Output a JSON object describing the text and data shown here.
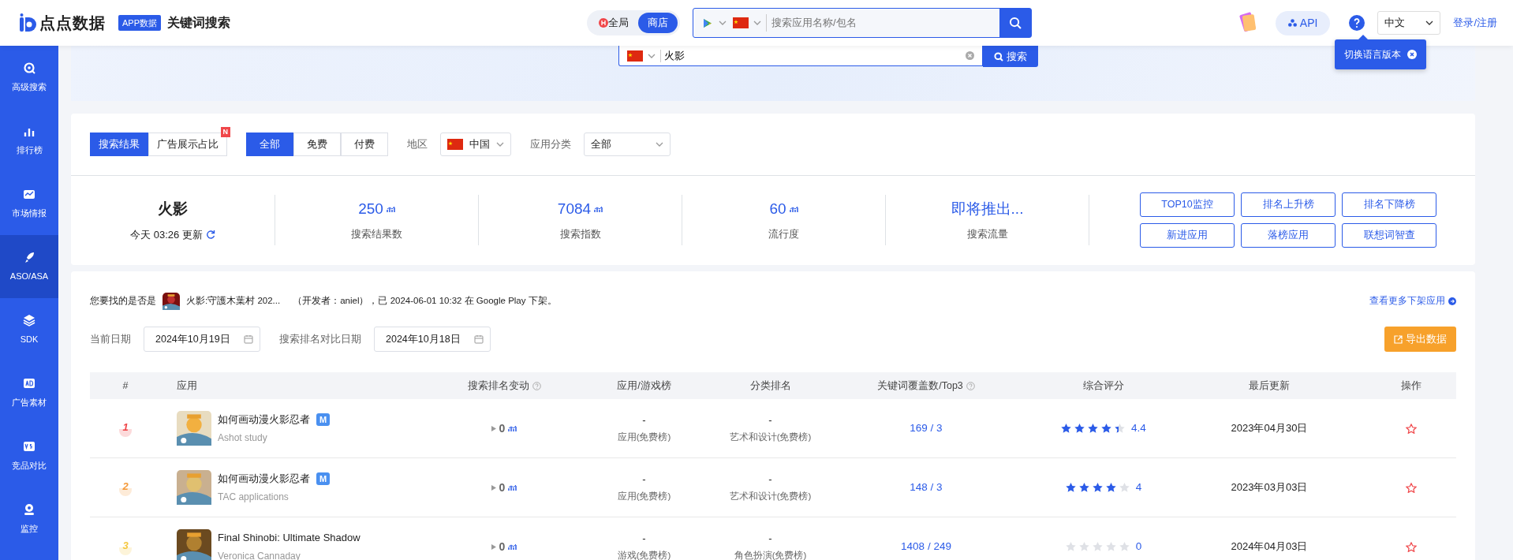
{
  "header": {
    "logo": "点点数据",
    "badge": "APP数据",
    "title": "关键词搜索",
    "scope_toggle": [
      {
        "label": "全局",
        "selected": false
      },
      {
        "label": "商店",
        "selected": true
      }
    ],
    "search": {
      "placeholder": "搜索应用名称/包名"
    },
    "api": "API",
    "language": "中文",
    "login": "登录/注册"
  },
  "tooltip": {
    "text": "切换语言版本"
  },
  "sidebar": {
    "items": [
      {
        "label": "高级搜索",
        "selected": false
      },
      {
        "label": "排行榜",
        "selected": false
      },
      {
        "label": "市场情报",
        "selected": false
      },
      {
        "label": "ASO/ASA",
        "selected": true
      },
      {
        "label": "SDK",
        "selected": false
      },
      {
        "label": "广告素材",
        "selected": false
      },
      {
        "label": "竞品对比",
        "selected": false
      },
      {
        "label": "监控",
        "selected": false
      }
    ]
  },
  "keyword_search": {
    "value": "火影",
    "button": "搜索"
  },
  "filters": {
    "result_tabs": [
      {
        "label": "搜索结果",
        "selected": true
      },
      {
        "label": "广告展示占比",
        "selected": false,
        "badge": "N"
      }
    ],
    "price_tabs": [
      {
        "label": "全部",
        "selected": true
      },
      {
        "label": "免费",
        "selected": false
      },
      {
        "label": "付费",
        "selected": false
      }
    ],
    "region": {
      "label": "地区",
      "value": "中国"
    },
    "category": {
      "label": "应用分类",
      "value": "全部"
    }
  },
  "summary": {
    "keyword": "火影",
    "updated": "今天 03:26 更新",
    "stats": [
      {
        "value": "250",
        "label": "搜索结果数",
        "chart_link": true
      },
      {
        "value": "7084",
        "label": "搜索指数",
        "chart_link": true
      },
      {
        "value": "60",
        "label": "流行度",
        "chart_link": true
      },
      {
        "value": "即将推出...",
        "label": "搜索流量",
        "chart_link": false
      }
    ],
    "actions": [
      "TOP10监控",
      "排名上升榜",
      "排名下降榜",
      "新进应用",
      "落榜应用",
      "联想词智查"
    ]
  },
  "notice": {
    "prefix": "您要找的是否是",
    "app_name": "火影:守護木葉村 202...",
    "details": "（开发者：aniel），已 2024-06-01 10:32 在 Google Play 下架。",
    "more_link": "查看更多下架应用"
  },
  "dates": {
    "current_label": "当前日期",
    "current": "2024年10月19日",
    "compare_label": "搜索排名对比日期",
    "compare": "2024年10月18日",
    "export": "导出数据"
  },
  "table": {
    "columns": [
      {
        "label": "#",
        "help": false
      },
      {
        "label": "应用",
        "help": false
      },
      {
        "label": "搜索排名变动",
        "help": true
      },
      {
        "label": "应用/游戏榜",
        "help": false
      },
      {
        "label": "分类排名",
        "help": false
      },
      {
        "label": "关键词覆盖数/Top3",
        "help": true
      },
      {
        "label": "综合评分",
        "help": false
      },
      {
        "label": "最后更新",
        "help": false
      },
      {
        "label": "操作",
        "help": false
      }
    ],
    "rows": [
      {
        "rank": "1",
        "color": "#f0474a",
        "app": "如何画动漫火影忍者",
        "badge": "M",
        "developer": "Ashot study",
        "rank_change": "0",
        "list_rank": "-",
        "list_name": "应用(免费榜)",
        "category_rank": "-",
        "category_name": "艺术和设计(免费榜)",
        "keywords": "169 / 3",
        "stars": 4.4,
        "rating": "4.4",
        "updated": "2023年04月30日"
      },
      {
        "rank": "2",
        "color": "#f59a3b",
        "app": "如何画动漫火影忍者",
        "badge": "M",
        "developer": "TAC applications",
        "rank_change": "0",
        "list_rank": "-",
        "list_name": "应用(免费榜)",
        "category_rank": "-",
        "category_name": "艺术和设计(免费榜)",
        "keywords": "148 / 3",
        "stars": 4,
        "rating": "4",
        "updated": "2023年03月03日"
      },
      {
        "rank": "3",
        "color": "#f5c842",
        "app": "Final Shinobi: Ultimate Shadow",
        "developer": "Veronica Cannaday",
        "rank_change": "0",
        "list_rank": "-",
        "list_name": "游戏(免费榜)",
        "category_rank": "-",
        "category_name": "角色扮演(免费榜)",
        "keywords": "1408 / 249",
        "stars": 0,
        "rating": "0",
        "updated": "2024年04月03日"
      }
    ]
  }
}
